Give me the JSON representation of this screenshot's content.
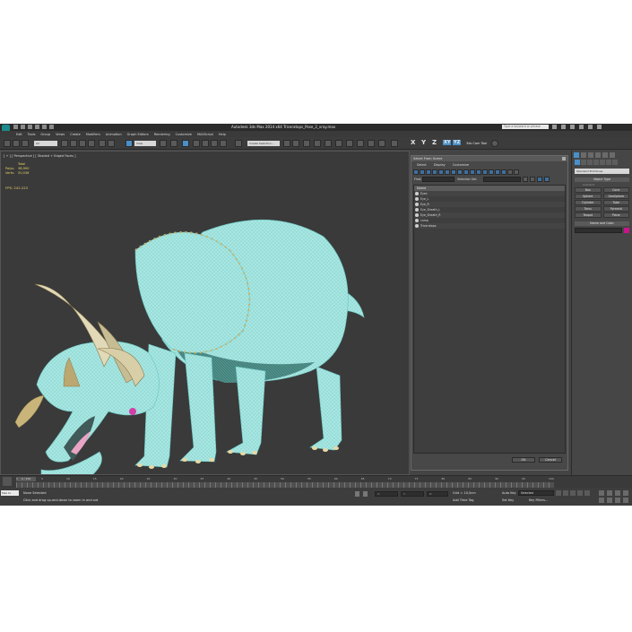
{
  "app": {
    "title": "Autodesk 3ds Max  2014 x64     Triceratops_Pose_2_vray.max",
    "search_placeholder": "Type a keyword or phrase"
  },
  "menu": [
    "Edit",
    "Tools",
    "Group",
    "Views",
    "Create",
    "Modifiers",
    "Animation",
    "Graph Editors",
    "Rendering",
    "Customize",
    "MAXScript",
    "Help"
  ],
  "toolbar": {
    "filter": "All",
    "ref_coord": "View",
    "selection_set": "Create Selection...",
    "axis_x": "X",
    "axis_y": "Y",
    "axis_z": "Z",
    "axis_xy": "XY",
    "axis_yz": "YZ",
    "cam_tool": "3ds Cam Tool"
  },
  "viewport": {
    "label": "[ + ] [ Perspective ] [ Shaded + Edged Faces ]",
    "stats_title": "Total",
    "polys_label": "Polys:",
    "polys_value": "98,990",
    "verts_label": "Verts:",
    "verts_value": "50,036",
    "fps_label": "FPS:",
    "fps_value": "242.223"
  },
  "select_dialog": {
    "title": "Select From Scene",
    "menu": [
      "Select",
      "Display",
      "Customize"
    ],
    "find_label": "Find:",
    "selection_set_label": "Selection Set:",
    "column_name": "Name",
    "items": [
      "Eyes",
      "Eye_L",
      "Eye_R",
      "Eye_Sheath_L",
      "Eye_Sheath_R",
      "Lamp",
      "Triceratops"
    ],
    "ok": "OK",
    "cancel": "Cancel"
  },
  "command_panel": {
    "category": "Standard Primitives",
    "object_type_title": "Object Type",
    "autogrid": "AutoGrid",
    "objects": [
      "Box",
      "Cone",
      "Sphere",
      "GeoSphere",
      "Cylinder",
      "Tube",
      "Torus",
      "Pyramid",
      "Teapot",
      "Plane"
    ],
    "name_color_title": "Name and Color",
    "color": "#c8148c"
  },
  "timeline": {
    "frame": "0 / 100",
    "ticks": [
      "0",
      "5",
      "10",
      "15",
      "20",
      "25",
      "30",
      "35",
      "40",
      "45",
      "50",
      "55",
      "60",
      "65",
      "70",
      "75",
      "80",
      "85",
      "90",
      "95",
      "100"
    ]
  },
  "status": {
    "script_label": "Max to",
    "line1": "None Selected",
    "line2": "Click and drag up-and-down to zoom in and out",
    "x_label": "X:",
    "y_label": "Y:",
    "z_label": "Z:",
    "grid": "Grid = 10,0cm",
    "add_time_tag": "Add Time Tag",
    "auto_key": "Auto Key",
    "selected": "Selected",
    "set_key": "Set Key",
    "key_filters": "Key Filters..."
  }
}
